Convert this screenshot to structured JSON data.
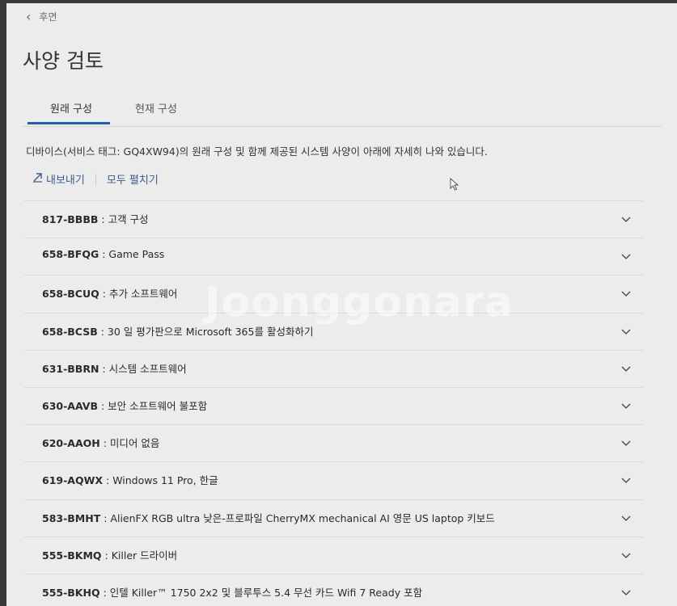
{
  "nav": {
    "back_label": "후면"
  },
  "page": {
    "title": "사양 검토",
    "tabs": [
      {
        "label": "원래 구성",
        "active": true
      },
      {
        "label": "현재 구성",
        "active": false
      }
    ],
    "description": "디바이스(서비스 태그: GQ4XW94)의 원래 구성 및 함께 제공된 시스템 사양이 아래에 자세히 나와 있습니다.",
    "actions": {
      "export_label": "내보내기",
      "expand_all_label": "모두 펼치기"
    }
  },
  "items": [
    {
      "code": "817-BBBB",
      "desc": "고객 구성"
    },
    {
      "code": "658-BFQG",
      "desc": "Game Pass"
    },
    {
      "code": "658-BCUQ",
      "desc": "추가 소프트웨어"
    },
    {
      "code": "658-BCSB",
      "desc": "30 일 평가판으로 Microsoft 365를 활성화하기"
    },
    {
      "code": "631-BBRN",
      "desc": "시스템 소프트웨어"
    },
    {
      "code": "630-AAVB",
      "desc": "보안 소프트웨어 불포함"
    },
    {
      "code": "620-AAOH",
      "desc": "미디어 없음"
    },
    {
      "code": "619-AQWX",
      "desc": "Windows 11 Pro, 한글"
    },
    {
      "code": "583-BMHT",
      "desc": "AlienFX RGB ultra 낮은-프로파일 CherryMX mechanical AI 영문 US laptop 키보드"
    },
    {
      "code": "555-BKMQ",
      "desc": "Killer 드라이버"
    },
    {
      "code": "555-BKHQ",
      "desc": "인텔 Killer™ 1750 2x2 및 블루투스 5.4 무선 카드 Wifi 7 Ready 포함"
    }
  ],
  "watermark": "Joonggonara",
  "colors": {
    "accent": "#1f5fb0",
    "link": "#3d5b8a"
  },
  "icons": {
    "back": "chevron-left-icon",
    "export": "export-arrow-icon",
    "row": "chevron-down-icon",
    "cursor": "mouse-pointer-icon"
  }
}
